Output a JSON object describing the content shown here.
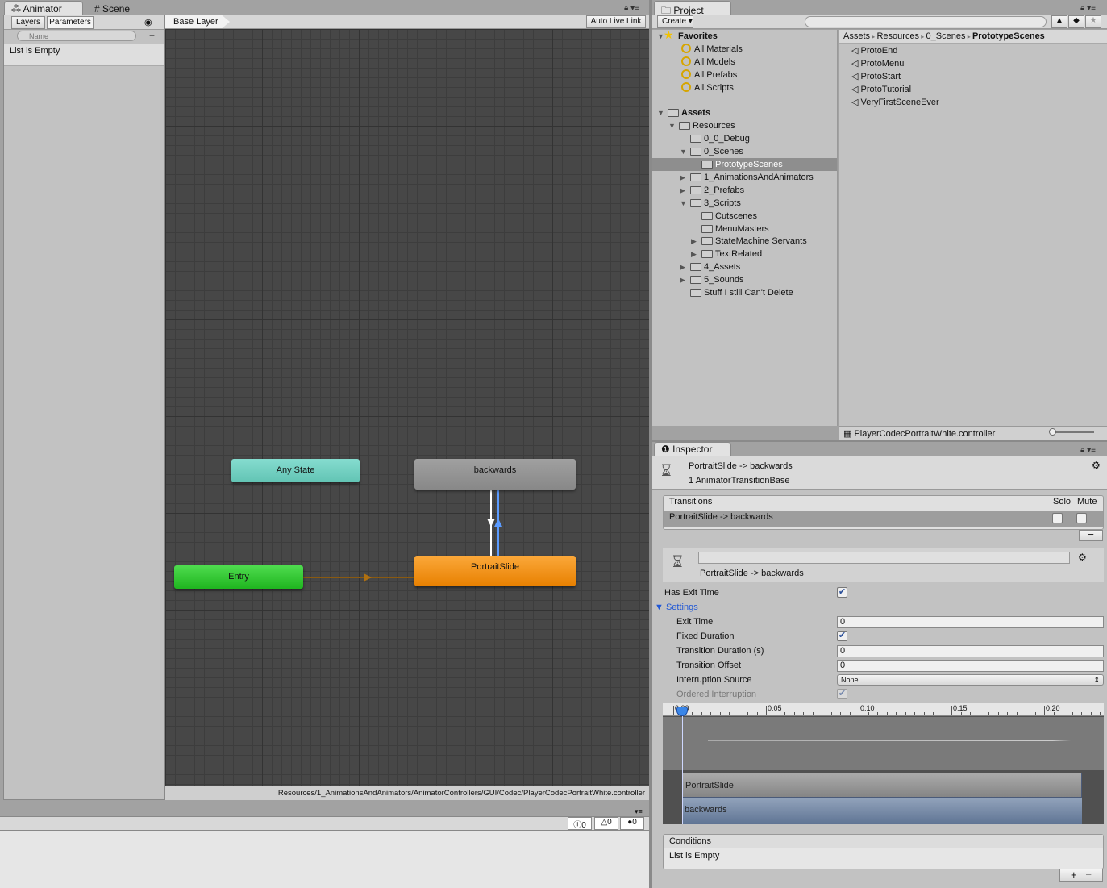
{
  "animator": {
    "tabs": [
      {
        "label": "Animator",
        "icon": "animator-icon"
      },
      {
        "label": "Scene",
        "icon": "grid-icon"
      }
    ],
    "subtabs": [
      "Layers",
      "Parameters"
    ],
    "search_placeholder": "Name",
    "params_empty": "List is Empty",
    "breadcrumb": "Base Layer",
    "auto_live_link": "Auto Live Link",
    "path": "Resources/1_AnimationsAndAnimators/AnimatorControllers/GUI/Codec/PlayerCodecPortraitWhite.controller",
    "states": {
      "any_state": "Any State",
      "backwards": "backwards",
      "portrait_slide": "PortraitSlide",
      "entry": "Entry"
    },
    "colors": {
      "any_state": "#72d1c2",
      "default_state": "#f28f12",
      "entry": "#2fc42f",
      "state": "#919191",
      "graph_bg": "#474747",
      "transition_selected": "#5b9bff"
    }
  },
  "console": {
    "info_count": "0",
    "warning_count": "0",
    "error_count": "0"
  },
  "project": {
    "tab": "Project",
    "create": "Create",
    "search_value": "",
    "breadcrumb": [
      "Assets",
      "Resources",
      "0_Scenes",
      "PrototypeScenes"
    ],
    "tree": [
      {
        "label": "Favorites",
        "depth": 0,
        "expanded": true,
        "type": "star",
        "bold": true
      },
      {
        "label": "All Materials",
        "depth": 1,
        "type": "search"
      },
      {
        "label": "All Models",
        "depth": 1,
        "type": "search"
      },
      {
        "label": "All Prefabs",
        "depth": 1,
        "type": "search"
      },
      {
        "label": "All Scripts",
        "depth": 1,
        "type": "search"
      },
      {
        "label": "",
        "depth": 0,
        "type": "spacer"
      },
      {
        "label": "Assets",
        "depth": 0,
        "expanded": true,
        "type": "folder",
        "bold": true
      },
      {
        "label": "Resources",
        "depth": 1,
        "expanded": true,
        "type": "folder"
      },
      {
        "label": "0_0_Debug",
        "depth": 2,
        "type": "folder"
      },
      {
        "label": "0_Scenes",
        "depth": 2,
        "expanded": true,
        "type": "folder"
      },
      {
        "label": "PrototypeScenes",
        "depth": 3,
        "type": "folder",
        "selected": true
      },
      {
        "label": "1_AnimationsAndAnimators",
        "depth": 2,
        "expanded": false,
        "type": "folder"
      },
      {
        "label": "2_Prefabs",
        "depth": 2,
        "expanded": false,
        "type": "folder"
      },
      {
        "label": "3_Scripts",
        "depth": 2,
        "expanded": true,
        "type": "folder"
      },
      {
        "label": "Cutscenes",
        "depth": 3,
        "type": "folder"
      },
      {
        "label": "MenuMasters",
        "depth": 3,
        "type": "folder"
      },
      {
        "label": "StateMachine Servants",
        "depth": 3,
        "expanded": false,
        "type": "folder"
      },
      {
        "label": "TextRelated",
        "depth": 3,
        "expanded": false,
        "type": "folder"
      },
      {
        "label": "4_Assets",
        "depth": 2,
        "expanded": false,
        "type": "folder"
      },
      {
        "label": "5_Sounds",
        "depth": 2,
        "expanded": false,
        "type": "folder"
      },
      {
        "label": "Stuff I still Can't Delete",
        "depth": 2,
        "type": "folder"
      }
    ],
    "files": [
      "ProtoEnd",
      "ProtoMenu",
      "ProtoStart",
      "ProtoTutorial",
      "VeryFirstSceneEver"
    ],
    "selected_asset": "PlayerCodecPortraitWhite.controller"
  },
  "inspector": {
    "tab": "Inspector",
    "title": "PortraitSlide -> backwards",
    "subtitle": "1 AnimatorTransitionBase",
    "transitions_header": "Transitions",
    "solo": "Solo",
    "mute": "Mute",
    "transitions": [
      {
        "label": "PortraitSlide -> backwards",
        "solo": false,
        "mute": false
      }
    ],
    "name_value": "",
    "transition_label": "PortraitSlide -> backwards",
    "has_exit_time": {
      "label": "Has Exit Time",
      "checked": true
    },
    "settings": "Settings",
    "exit_time": {
      "label": "Exit Time",
      "value": "0"
    },
    "fixed_duration": {
      "label": "Fixed Duration",
      "checked": true
    },
    "transition_duration": {
      "label": "Transition Duration (s)",
      "value": "0"
    },
    "transition_offset": {
      "label": "Transition Offset",
      "value": "0"
    },
    "interruption_source": {
      "label": "Interruption Source",
      "value": "None"
    },
    "ordered_interruption": {
      "label": "Ordered Interruption",
      "checked": true
    },
    "timeline": {
      "ticks": [
        "0:00",
        "0:05",
        "0:10",
        "0:15",
        "0:20"
      ],
      "tracks": [
        "PortraitSlide",
        "backwards"
      ]
    },
    "conditions_header": "Conditions",
    "conditions_empty": "List is Empty"
  }
}
